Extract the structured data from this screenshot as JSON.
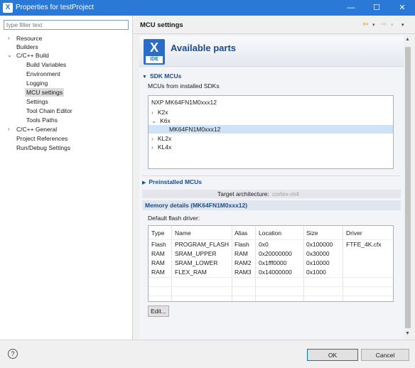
{
  "window": {
    "title": "Properties for testProject",
    "minimize": "—",
    "maximize": "☐",
    "close": "✕"
  },
  "filter": {
    "placeholder": "type filter text"
  },
  "tree": {
    "resource": "Resource",
    "builders": "Builders",
    "cc_build": "C/C++ Build",
    "build_variables": "Build Variables",
    "environment": "Environment",
    "logging": "Logging",
    "mcu_settings": "MCU settings",
    "settings": "Settings",
    "tool_chain_editor": "Tool Chain Editor",
    "tools_paths": "Tools Paths",
    "cc_general": "C/C++ General",
    "project_references": "Project References",
    "run_debug_settings": "Run/Debug Settings"
  },
  "header": {
    "title": "MCU settings"
  },
  "banner": {
    "logo_letter": "X",
    "logo_label": "IDE",
    "title": "Available parts"
  },
  "sdk": {
    "section_title": "SDK MCUs",
    "description": "MCUs from installed SDKs",
    "root": "NXP MK64FN1M0xxx12",
    "k2x": "K2x",
    "k6x": "K6x",
    "selected_part": "MK64FN1M0xxx12",
    "kl2x": "KL2x",
    "kl4x": "KL4x"
  },
  "preinstalled": {
    "section_title": "Preinstalled MCUs"
  },
  "target": {
    "label": "Target architecture:",
    "value": "cortex-m4"
  },
  "memory": {
    "section_title": "Memory details (MK64FN1M0xxx12)",
    "default_flash_label": "Default flash driver:",
    "columns": [
      "Type",
      "Name",
      "Alias",
      "Location",
      "Size",
      "Driver"
    ],
    "rows": [
      [
        "Flash",
        "PROGRAM_FLASH",
        "Flash",
        "0x0",
        "0x100000",
        "FTFE_4K.cfx"
      ],
      [
        "RAM",
        "SRAM_UPPER",
        "RAM",
        "0x20000000",
        "0x30000",
        ""
      ],
      [
        "RAM",
        "SRAM_LOWER",
        "RAM2",
        "0x1fff0000",
        "0x10000",
        ""
      ],
      [
        "RAM",
        "FLEX_RAM",
        "RAM3",
        "0x14000000",
        "0x1000",
        ""
      ]
    ],
    "edit_button": "Edit..."
  },
  "footer": {
    "help": "?",
    "ok": "OK",
    "cancel": "Cancel"
  },
  "colors": {
    "titlebar": "#2b79d6",
    "accent_text": "#1a4b8c",
    "selection": "#cfe3f7"
  }
}
